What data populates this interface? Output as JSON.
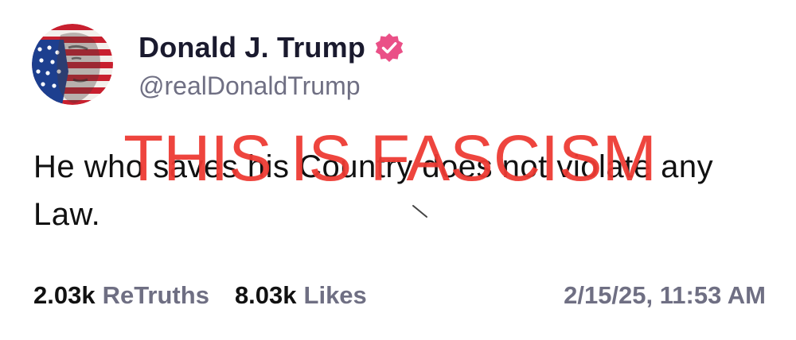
{
  "author": {
    "display_name": "Donald J. Trump",
    "handle": "@realDonaldTrump",
    "verified": true,
    "badge_color": "#ea5087"
  },
  "post": {
    "text": "He who saves his Country does not violate any Law."
  },
  "overlay": {
    "text": "THIS IS FASCISM",
    "color": "#ee3a32"
  },
  "stats": {
    "retruths_count": "2.03k",
    "retruths_label": "ReTruths",
    "likes_count": "8.03k",
    "likes_label": "Likes",
    "timestamp": "2/15/25, 11:53 AM"
  }
}
